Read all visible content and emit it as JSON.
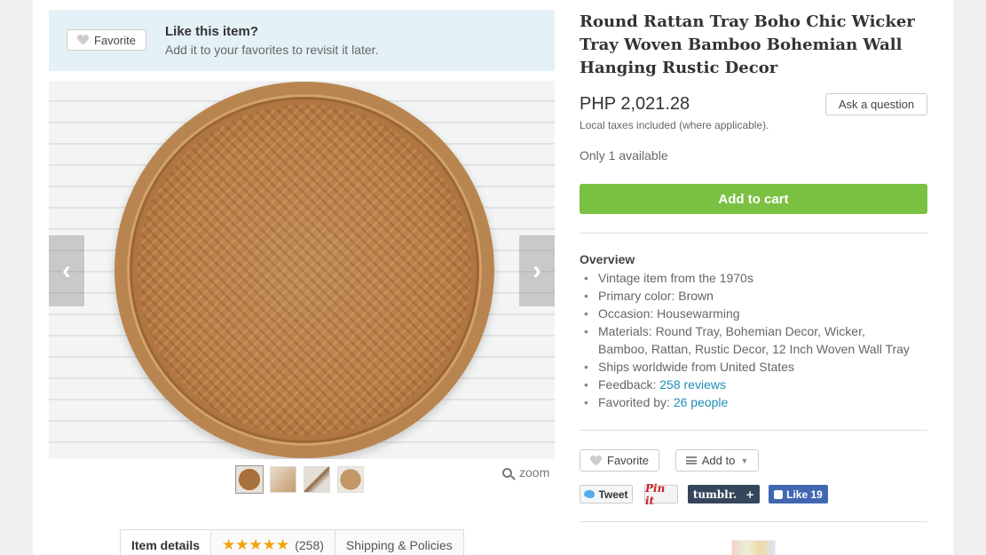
{
  "favorite_banner": {
    "button_label": "Favorite",
    "title": "Like this item?",
    "subtitle": "Add it to your favorites to revisit it later."
  },
  "gallery": {
    "thumbnails": [
      "thumbnail-1",
      "thumbnail-2",
      "thumbnail-3",
      "thumbnail-4"
    ],
    "zoom_label": "zoom",
    "prev_icon": "chevron-left-icon",
    "next_icon": "chevron-right-icon"
  },
  "tabs": {
    "item_details": "Item details",
    "reviews_stars": "★★★★★",
    "reviews_count": "(258)",
    "shipping": "Shipping & Policies"
  },
  "listing": {
    "title": "Round Rattan Tray Boho Chic Wicker Tray Woven Bamboo Bohemian Wall Hanging Rustic Decor",
    "price": "PHP 2,021.28",
    "taxes_note": "Local taxes included (where applicable).",
    "ask_button": "Ask a question",
    "availability": "Only 1 available",
    "add_to_cart": "Add to cart"
  },
  "overview": {
    "heading": "Overview",
    "item_1": "Vintage item from the 1970s",
    "item_2": "Primary color: Brown",
    "item_3": "Occasion: Housewarming",
    "item_4a": "Materials: Round Tray, Bohemian Decor, Wicker,",
    "item_4b": "Bamboo, Rattan, Rustic Decor, 12 Inch Woven Wall Tray",
    "item_5": "Ships worldwide from United States",
    "feedback_label": "Feedback:",
    "feedback_link": "258 reviews",
    "favorited_label": "Favorited by:",
    "favorited_link": "26 people"
  },
  "actions": {
    "favorite": "Favorite",
    "add_to": "Add to",
    "tweet": "Tweet",
    "pin": "Pin it",
    "tumblr": "tumblr.",
    "tumblr_plus": "+",
    "fb_like": "Like 19"
  },
  "colors": {
    "cart_green": "#7ac142",
    "link_blue": "#1f8fb8",
    "banner_bg": "#e4f1f6",
    "star_orange": "#f1a20b"
  }
}
